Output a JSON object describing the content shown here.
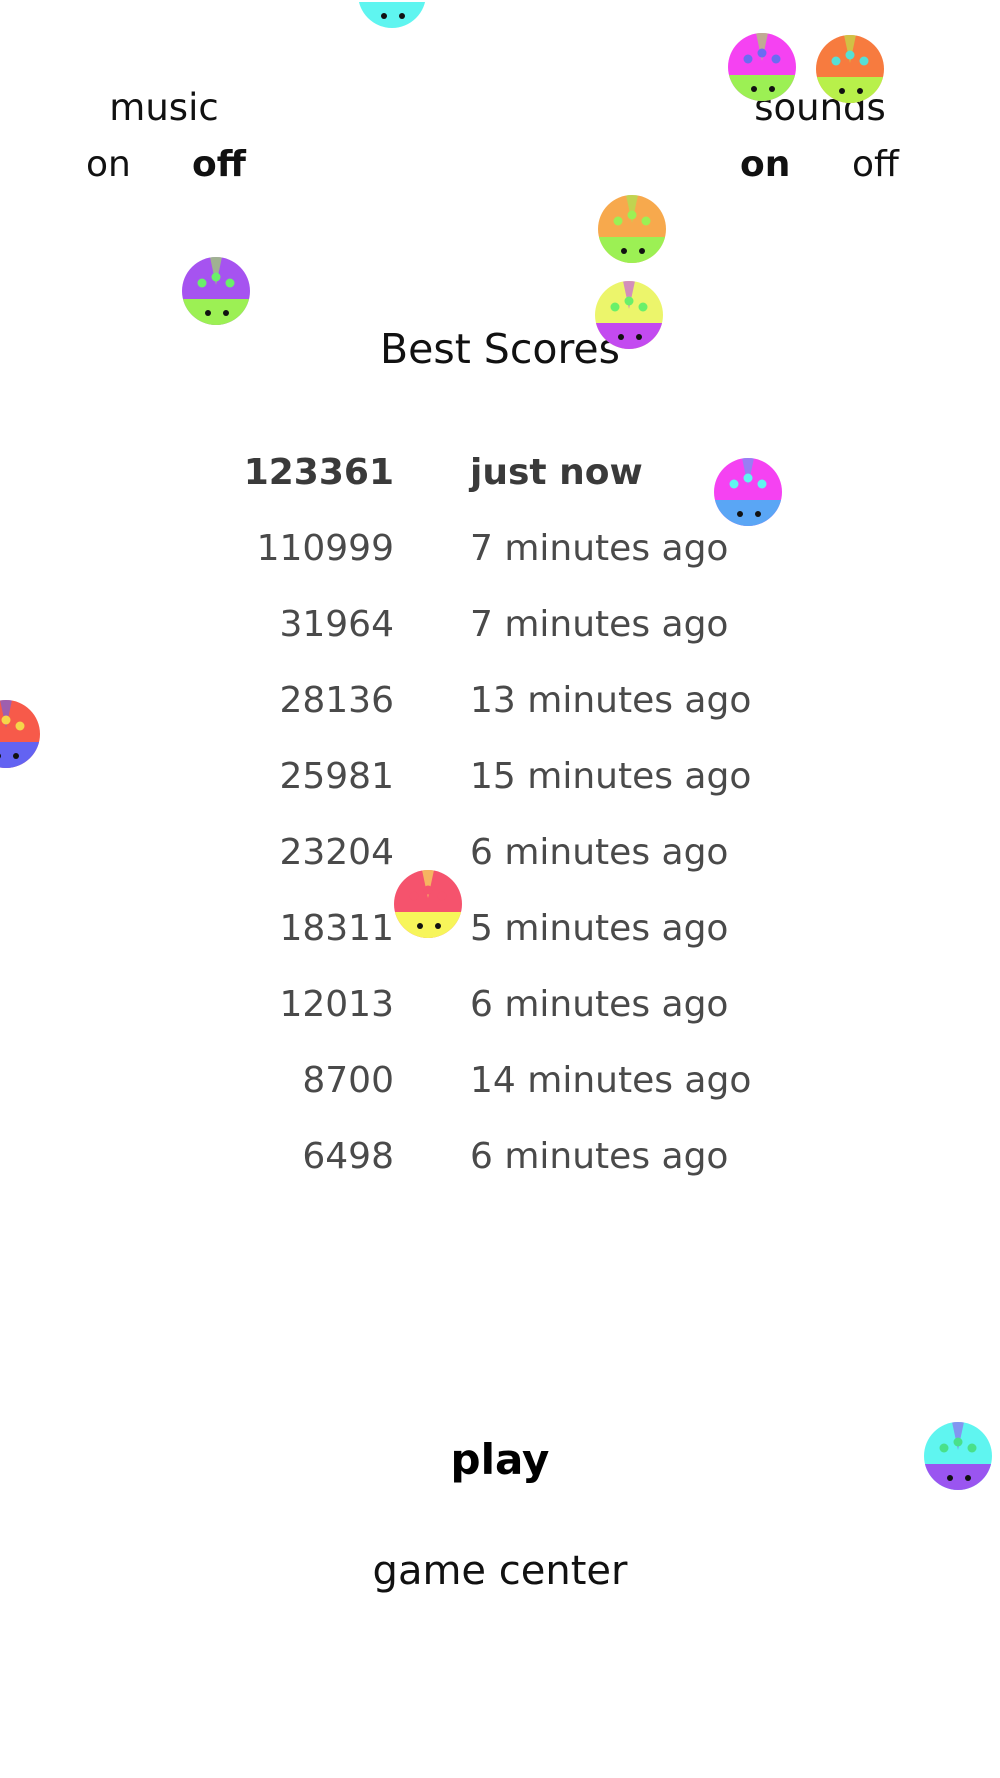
{
  "music": {
    "title": "music",
    "on_label": "on",
    "off_label": "off",
    "selected": "off"
  },
  "sounds": {
    "title": "sounds",
    "on_label": "on",
    "off_label": "off",
    "selected": "on"
  },
  "best_scores": {
    "heading": "Best Scores",
    "rows": [
      {
        "score": "123361",
        "when": "just now",
        "latest": true
      },
      {
        "score": "110999",
        "when": "7 minutes ago"
      },
      {
        "score": "31964",
        "when": "7 minutes ago"
      },
      {
        "score": "28136",
        "when": "13 minutes ago"
      },
      {
        "score": "25981",
        "when": "15 minutes ago"
      },
      {
        "score": "23204",
        "when": "6 minutes ago"
      },
      {
        "score": "18311",
        "when": "5 minutes ago"
      },
      {
        "score": "12013",
        "when": "6 minutes ago"
      },
      {
        "score": "8700",
        "when": "14 minutes ago"
      },
      {
        "score": "6498",
        "when": "6 minutes ago"
      }
    ]
  },
  "menu": {
    "play_label": "play",
    "game_center_label": "game center"
  },
  "bug_sprites": [
    {
      "name": "bug-sprite-cyan-top",
      "top_color": "#ffffff",
      "bottom_color": "#5ff5f0",
      "spot_color": "#49e08a"
    },
    {
      "name": "bug-sprite-magenta",
      "top_color": "#f542f2",
      "bottom_color": "#9cf054",
      "spot_color": "#6a6cf2"
    },
    {
      "name": "bug-sprite-orange",
      "top_color": "#f77b3f",
      "bottom_color": "#b8f04a",
      "spot_color": "#56e0d6"
    },
    {
      "name": "bug-sprite-lime-orange",
      "top_color": "#f7a94d",
      "bottom_color": "#9cf054",
      "spot_color": "#9cf054"
    },
    {
      "name": "bug-sprite-purple",
      "top_color": "#a653f0",
      "bottom_color": "#9cf054",
      "spot_color": "#6af06a"
    },
    {
      "name": "bug-sprite-yellow-purple",
      "top_color": "#ecf56b",
      "bottom_color": "#c34af0",
      "spot_color": "#6af06a"
    },
    {
      "name": "bug-sprite-pink-blue",
      "top_color": "#f542f2",
      "bottom_color": "#5aa6f5",
      "spot_color": "#5ff5f0"
    },
    {
      "name": "bug-sprite-red-blue",
      "top_color": "#f75a4a",
      "bottom_color": "#6363f2",
      "spot_color": "#f5d64a"
    },
    {
      "name": "bug-sprite-pink-yellow",
      "top_color": "#f5536d",
      "bottom_color": "#f7f55a",
      "spot_color": "#f5536d"
    },
    {
      "name": "bug-sprite-cyan-purple",
      "top_color": "#5ff5f0",
      "bottom_color": "#9a55f0",
      "spot_color": "#49e08a"
    }
  ]
}
